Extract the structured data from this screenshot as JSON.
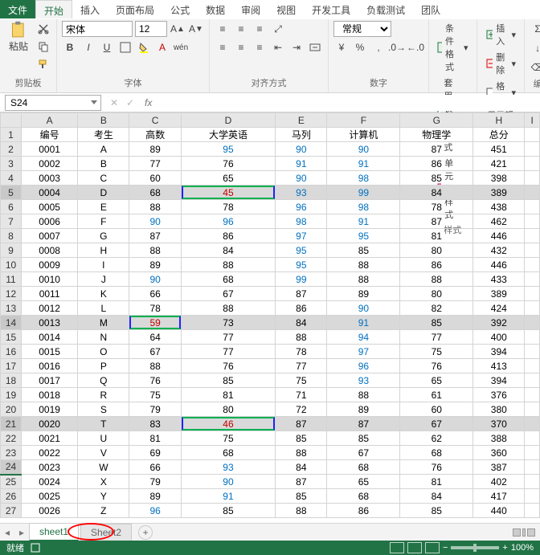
{
  "menu": {
    "file": "文件",
    "start": "开始",
    "insert": "插入",
    "layout": "页面布局",
    "formula": "公式",
    "data": "数据",
    "review": "审阅",
    "view": "视图",
    "dev": "开发工具",
    "load": "负载测试",
    "team": "团队"
  },
  "ribbon": {
    "clipboard": {
      "paste": "粘贴",
      "label": "剪贴板"
    },
    "font": {
      "name": "宋体",
      "size": "12",
      "label": "字体"
    },
    "align": {
      "label": "对齐方式"
    },
    "number": {
      "general": "常规",
      "label": "数字"
    },
    "styles": {
      "cond": "条件格式",
      "tbl": "套用表格格式",
      "cell": "单元格样式",
      "label": "样式"
    },
    "cells": {
      "ins": "插入",
      "del": "删除",
      "fmt": "格式",
      "label": "单元格"
    },
    "edit": {
      "label": "编"
    }
  },
  "namebox": "S24",
  "headers": [
    "A",
    "B",
    "C",
    "D",
    "E",
    "F",
    "G",
    "H",
    "I"
  ],
  "titles": [
    "编号",
    "考生",
    "高数",
    "大学英语",
    "马列",
    "计算机",
    "物理学",
    "总分"
  ],
  "rows": [
    {
      "n": "0001",
      "s": "A",
      "v": [
        89,
        95,
        90,
        90,
        87,
        451
      ],
      "b": [
        0,
        1,
        1,
        1,
        0,
        0
      ]
    },
    {
      "n": "0002",
      "s": "B",
      "v": [
        77,
        76,
        91,
        91,
        86,
        421
      ],
      "b": [
        0,
        0,
        1,
        1,
        0,
        0
      ]
    },
    {
      "n": "0003",
      "s": "C",
      "v": [
        60,
        65,
        90,
        98,
        85,
        398
      ],
      "b": [
        0,
        0,
        1,
        1,
        0,
        0
      ]
    },
    {
      "n": "0004",
      "s": "D",
      "v": [
        68,
        45,
        93,
        99,
        84,
        389
      ],
      "b": [
        0,
        2,
        1,
        1,
        0,
        0
      ],
      "hl": 1,
      "box": 1
    },
    {
      "n": "0005",
      "s": "E",
      "v": [
        88,
        78,
        96,
        98,
        78,
        438
      ],
      "b": [
        0,
        0,
        1,
        1,
        0,
        0
      ]
    },
    {
      "n": "0006",
      "s": "F",
      "v": [
        90,
        96,
        98,
        91,
        87,
        462
      ],
      "b": [
        1,
        1,
        1,
        1,
        0,
        0
      ]
    },
    {
      "n": "0007",
      "s": "G",
      "v": [
        87,
        86,
        97,
        95,
        81,
        446
      ],
      "b": [
        0,
        0,
        1,
        1,
        0,
        0
      ]
    },
    {
      "n": "0008",
      "s": "H",
      "v": [
        88,
        84,
        95,
        85,
        80,
        432
      ],
      "b": [
        0,
        0,
        1,
        0,
        0,
        0
      ]
    },
    {
      "n": "0009",
      "s": "I",
      "v": [
        89,
        88,
        95,
        88,
        86,
        446
      ],
      "b": [
        0,
        0,
        1,
        0,
        0,
        0
      ]
    },
    {
      "n": "0010",
      "s": "J",
      "v": [
        90,
        68,
        99,
        88,
        88,
        433
      ],
      "b": [
        1,
        0,
        1,
        0,
        0,
        0
      ]
    },
    {
      "n": "0011",
      "s": "K",
      "v": [
        66,
        67,
        87,
        89,
        80,
        389
      ],
      "b": [
        0,
        0,
        0,
        0,
        0,
        0
      ]
    },
    {
      "n": "0012",
      "s": "L",
      "v": [
        78,
        88,
        86,
        90,
        82,
        424
      ],
      "b": [
        0,
        0,
        0,
        1,
        0,
        0
      ]
    },
    {
      "n": "0013",
      "s": "M",
      "v": [
        59,
        73,
        84,
        91,
        85,
        392
      ],
      "b": [
        2,
        0,
        0,
        1,
        0,
        0
      ],
      "hl": 1,
      "boxC": 1
    },
    {
      "n": "0014",
      "s": "N",
      "v": [
        64,
        77,
        88,
        94,
        77,
        400
      ],
      "b": [
        0,
        0,
        0,
        1,
        0,
        0
      ]
    },
    {
      "n": "0015",
      "s": "O",
      "v": [
        67,
        77,
        78,
        97,
        75,
        394
      ],
      "b": [
        0,
        0,
        0,
        1,
        0,
        0
      ]
    },
    {
      "n": "0016",
      "s": "P",
      "v": [
        88,
        76,
        77,
        96,
        76,
        413
      ],
      "b": [
        0,
        0,
        0,
        1,
        0,
        0
      ]
    },
    {
      "n": "0017",
      "s": "Q",
      "v": [
        76,
        85,
        75,
        93,
        65,
        394
      ],
      "b": [
        0,
        0,
        0,
        1,
        0,
        0
      ]
    },
    {
      "n": "0018",
      "s": "R",
      "v": [
        75,
        81,
        71,
        88,
        61,
        376
      ],
      "b": [
        0,
        0,
        0,
        0,
        0,
        0
      ]
    },
    {
      "n": "0019",
      "s": "S",
      "v": [
        79,
        80,
        72,
        89,
        60,
        380
      ],
      "b": [
        0,
        0,
        0,
        0,
        0,
        0
      ]
    },
    {
      "n": "0020",
      "s": "T",
      "v": [
        83,
        46,
        87,
        87,
        67,
        370
      ],
      "b": [
        0,
        2,
        0,
        0,
        0,
        0
      ],
      "hl": 1,
      "box": 1
    },
    {
      "n": "0021",
      "s": "U",
      "v": [
        81,
        75,
        85,
        85,
        62,
        388
      ],
      "b": [
        0,
        0,
        0,
        0,
        0,
        0
      ]
    },
    {
      "n": "0022",
      "s": "V",
      "v": [
        69,
        68,
        88,
        67,
        68,
        360
      ],
      "b": [
        0,
        0,
        0,
        0,
        0,
        0
      ]
    },
    {
      "n": "0023",
      "s": "W",
      "v": [
        66,
        93,
        84,
        68,
        76,
        387
      ],
      "b": [
        0,
        1,
        0,
        0,
        0,
        0
      ]
    },
    {
      "n": "0024",
      "s": "X",
      "v": [
        79,
        90,
        87,
        65,
        81,
        402
      ],
      "b": [
        0,
        1,
        0,
        0,
        0,
        0
      ]
    },
    {
      "n": "0025",
      "s": "Y",
      "v": [
        89,
        91,
        85,
        68,
        84,
        417
      ],
      "b": [
        0,
        1,
        0,
        0,
        0,
        0
      ]
    },
    {
      "n": "0026",
      "s": "Z",
      "v": [
        96,
        85,
        88,
        86,
        85,
        440
      ],
      "b": [
        1,
        0,
        0,
        0,
        0,
        0
      ]
    }
  ],
  "sheets": {
    "s1": "sheet1",
    "s2": "Sheet2"
  },
  "status": {
    "ready": "就绪",
    "zoom": "100%"
  },
  "active_row": 24
}
